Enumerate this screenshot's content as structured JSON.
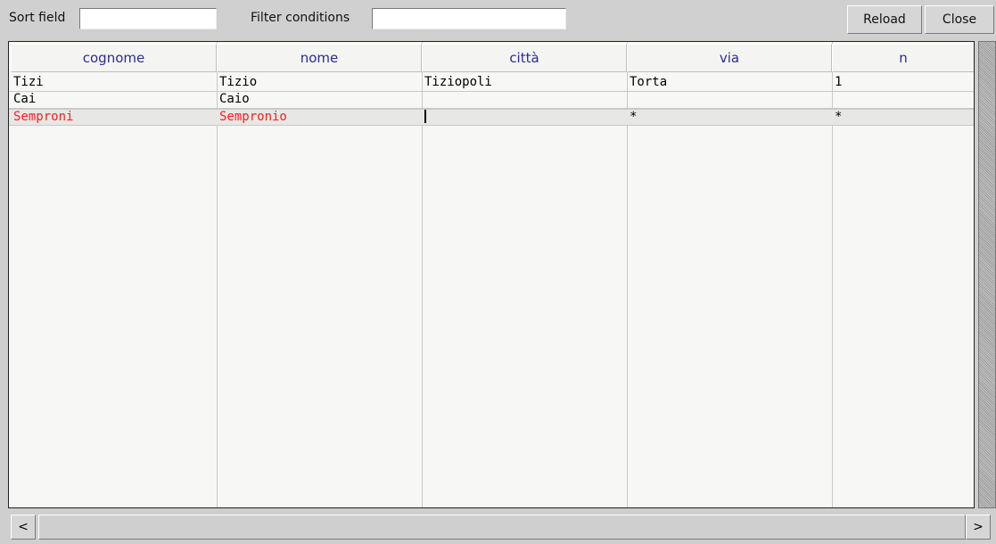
{
  "toolbar": {
    "sort_label": "Sort field",
    "sort_value": "",
    "filter_label": "Filter conditions",
    "filter_value": "",
    "reload_label": "Reload",
    "close_label": "Close"
  },
  "columns": [
    "cognome",
    "nome",
    "città",
    "via",
    "n"
  ],
  "rows": [
    [
      "Tizi",
      "Tizio",
      "Tiziopoli",
      "Torta",
      "1"
    ],
    [
      "Cai",
      "Caio",
      "",
      "",
      ""
    ],
    [
      "Semproni",
      "Sempronio",
      "",
      "*",
      "*"
    ]
  ],
  "scroll": {
    "left_arrow": "<",
    "right_arrow": ">"
  },
  "colors": {
    "header_text": "#2a2a9a",
    "edit_row_text": "#ff1a1a",
    "grid_bg": "#f7f8f5"
  }
}
